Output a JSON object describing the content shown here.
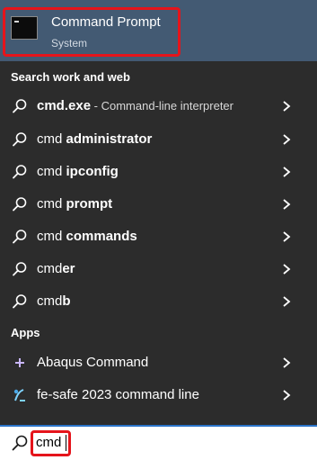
{
  "top_result": {
    "title": "Command Prompt",
    "subtitle": "System",
    "icon": "command-prompt-icon"
  },
  "sections": {
    "web_header": "Search work and web",
    "apps_header": "Apps"
  },
  "web_results": [
    {
      "prefix": "cmd.exe",
      "bold": "",
      "desc": " - Command-line interpreter",
      "icon": "search-icon"
    },
    {
      "prefix": "cmd ",
      "bold": "administrator",
      "desc": "",
      "icon": "search-icon"
    },
    {
      "prefix": "cmd ",
      "bold": "ipconfig",
      "desc": "",
      "icon": "search-icon"
    },
    {
      "prefix": "cmd ",
      "bold": "prompt",
      "desc": "",
      "icon": "search-icon"
    },
    {
      "prefix": "cmd ",
      "bold": "commands",
      "desc": "",
      "icon": "search-icon"
    },
    {
      "prefix": "cmd",
      "bold": "er",
      "desc": "",
      "icon": "search-icon"
    },
    {
      "prefix": "cmd",
      "bold": "b",
      "desc": "",
      "icon": "search-icon"
    }
  ],
  "apps": [
    {
      "label": "Abaqus Command",
      "icon": "abaqus-icon"
    },
    {
      "label": "fe-safe 2023 command line",
      "icon": "fe-safe-icon"
    }
  ],
  "search": {
    "value": "cmd"
  },
  "colors": {
    "background": "#2c2c2c",
    "selected": "#435a73",
    "highlight_border": "#e5141b",
    "search_accent": "#2a73c9"
  }
}
